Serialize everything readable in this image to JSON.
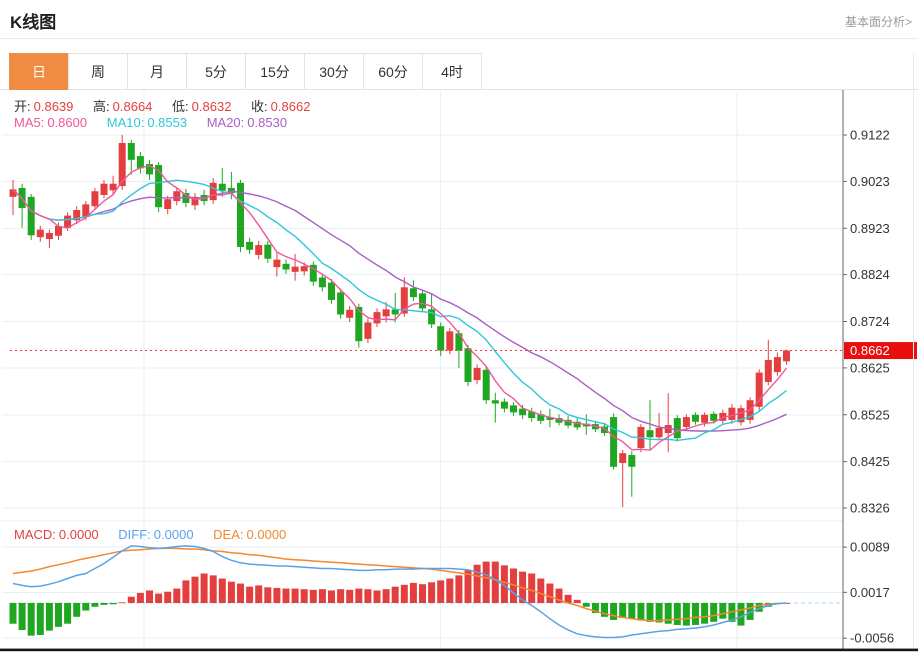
{
  "header": {
    "title": "K线图",
    "link_label": "基本面分析>"
  },
  "tabs": [
    {
      "label": "日",
      "active": true
    },
    {
      "label": "周",
      "active": false
    },
    {
      "label": "月",
      "active": false
    },
    {
      "label": "5分",
      "active": false
    },
    {
      "label": "15分",
      "active": false
    },
    {
      "label": "30分",
      "active": false
    },
    {
      "label": "60分",
      "active": false
    },
    {
      "label": "4时",
      "active": false
    }
  ],
  "ohlc_row": {
    "open_label": "开:",
    "open": "0.8639",
    "high_label": "高:",
    "high": "0.8664",
    "low_label": "低:",
    "low": "0.8632",
    "close_label": "收:",
    "close": "0.8662"
  },
  "ma_row": {
    "ma5_label": "MA5:",
    "ma5": "0.8600",
    "ma10_label": "MA10:",
    "ma10": "0.8553",
    "ma20_label": "MA20:",
    "ma20": "0.8530"
  },
  "macd_row": {
    "macd_label": "MACD:",
    "macd": "0.0000",
    "diff_label": "DIFF:",
    "diff": "0.0000",
    "dea_label": "DEA:",
    "dea": "0.0000"
  },
  "colors": {
    "accent_orange": "#f08c43",
    "candle_up": "#e43f3f",
    "candle_down": "#1fa722",
    "ma5_pink": "#f0579a",
    "ma10_cyan": "#2fc6da",
    "ma20_purple": "#a95fc4",
    "diff_blue": "#58a3e8",
    "dea_orange": "#f2882f",
    "price_tag_bg": "#ea0f0f",
    "price_line_red": "#f03c3c",
    "grid": "#e9eff6",
    "zero_dash": "#a8d8f0",
    "axis": "#666666"
  },
  "chart_data": [
    {
      "type": "candlestick",
      "title": "K线图",
      "legend": [
        "MA5",
        "MA10",
        "MA20"
      ],
      "ma_windows": [
        5,
        10,
        20
      ],
      "y_axis": {
        "ticks": [
          "0.9122",
          "0.9023",
          "0.8923",
          "0.8824",
          "0.8724",
          "0.8625",
          "0.8525",
          "0.8425",
          "0.8326"
        ],
        "range": [
          0.8326,
          0.9122
        ],
        "grid": true
      },
      "current_price": "0.8662",
      "current_price_value": 0.8662,
      "candles": [
        [
          0.899,
          0.9026,
          0.8951,
          0.9006
        ],
        [
          0.9009,
          0.9018,
          0.8924,
          0.8966
        ],
        [
          0.899,
          0.8996,
          0.8898,
          0.8908
        ],
        [
          0.8904,
          0.8928,
          0.8894,
          0.892
        ],
        [
          0.89,
          0.892,
          0.8881,
          0.8913
        ],
        [
          0.8907,
          0.8935,
          0.8898,
          0.8928
        ],
        [
          0.8924,
          0.8957,
          0.8917,
          0.895
        ],
        [
          0.894,
          0.897,
          0.8932,
          0.8962
        ],
        [
          0.8947,
          0.8981,
          0.894,
          0.8974
        ],
        [
          0.897,
          0.9009,
          0.8962,
          0.9002
        ],
        [
          0.8994,
          0.9026,
          0.8987,
          0.9018
        ],
        [
          0.9004,
          0.9035,
          0.8996,
          0.9018
        ],
        [
          0.9013,
          0.9122,
          0.9005,
          0.9105
        ],
        [
          0.9105,
          0.9112,
          0.9037,
          0.9069
        ],
        [
          0.9077,
          0.9086,
          0.904,
          0.9051
        ],
        [
          0.906,
          0.9068,
          0.9026,
          0.9038
        ],
        [
          0.9058,
          0.9064,
          0.8958,
          0.8968
        ],
        [
          0.8964,
          0.8992,
          0.8953,
          0.8985
        ],
        [
          0.8981,
          0.9011,
          0.8972,
          0.9002
        ],
        [
          0.8998,
          0.9007,
          0.8968,
          0.8977
        ],
        [
          0.8972,
          0.8998,
          0.8962,
          0.899
        ],
        [
          0.8994,
          0.9005,
          0.8972,
          0.8981
        ],
        [
          0.8983,
          0.903,
          0.8975,
          0.902
        ],
        [
          0.9018,
          0.9052,
          0.899,
          0.9003
        ],
        [
          0.9009,
          0.9043,
          0.8985,
          0.8998
        ],
        [
          0.902,
          0.9026,
          0.8872,
          0.8883
        ],
        [
          0.8894,
          0.8903,
          0.8868,
          0.8877
        ],
        [
          0.8866,
          0.8896,
          0.8857,
          0.8887
        ],
        [
          0.8888,
          0.8896,
          0.8849,
          0.8858
        ],
        [
          0.884,
          0.8872,
          0.882,
          0.8856
        ],
        [
          0.8847,
          0.8856,
          0.8826,
          0.8835
        ],
        [
          0.883,
          0.8868,
          0.8811,
          0.8841
        ],
        [
          0.8831,
          0.885,
          0.8822,
          0.8842
        ],
        [
          0.8845,
          0.8852,
          0.88,
          0.8809
        ],
        [
          0.8818,
          0.8826,
          0.8788,
          0.8797
        ],
        [
          0.8807,
          0.8815,
          0.8762,
          0.877
        ],
        [
          0.8786,
          0.8794,
          0.873,
          0.8739
        ],
        [
          0.8732,
          0.8757,
          0.8723,
          0.8749
        ],
        [
          0.8755,
          0.8762,
          0.8668,
          0.8682
        ],
        [
          0.8687,
          0.873,
          0.8678,
          0.8722
        ],
        [
          0.872,
          0.8752,
          0.8712,
          0.8744
        ],
        [
          0.8735,
          0.8766,
          0.8722,
          0.875
        ],
        [
          0.875,
          0.8785,
          0.8722,
          0.8739
        ],
        [
          0.8741,
          0.8818,
          0.8734,
          0.8797
        ],
        [
          0.8795,
          0.8812,
          0.8768,
          0.8776
        ],
        [
          0.8784,
          0.8792,
          0.8744,
          0.8752
        ],
        [
          0.875,
          0.8784,
          0.871,
          0.8718
        ],
        [
          0.8714,
          0.8722,
          0.865,
          0.8662
        ],
        [
          0.8662,
          0.871,
          0.8654,
          0.8703
        ],
        [
          0.8699,
          0.8706,
          0.8625,
          0.8662
        ],
        [
          0.8667,
          0.8674,
          0.8586,
          0.8595
        ],
        [
          0.8599,
          0.8632,
          0.859,
          0.8625
        ],
        [
          0.8621,
          0.8628,
          0.8548,
          0.8556
        ],
        [
          0.8556,
          0.8572,
          0.8508,
          0.8549
        ],
        [
          0.8553,
          0.856,
          0.853,
          0.8538
        ],
        [
          0.8545,
          0.8552,
          0.8522,
          0.853
        ],
        [
          0.8538,
          0.8546,
          0.8516,
          0.8524
        ],
        [
          0.8532,
          0.854,
          0.851,
          0.8518
        ],
        [
          0.8526,
          0.8534,
          0.8505,
          0.8512
        ],
        [
          0.852,
          0.8538,
          0.8498,
          0.8514
        ],
        [
          0.8518,
          0.8526,
          0.8502,
          0.8508
        ],
        [
          0.8514,
          0.8522,
          0.8496,
          0.8502
        ],
        [
          0.851,
          0.8518,
          0.8492,
          0.8498
        ],
        [
          0.8506,
          0.8526,
          0.8482,
          0.85
        ],
        [
          0.8505,
          0.8512,
          0.8488,
          0.8494
        ],
        [
          0.85,
          0.8508,
          0.848,
          0.8486
        ],
        [
          0.852,
          0.8528,
          0.8408,
          0.8414
        ],
        [
          0.8422,
          0.845,
          0.8328,
          0.8443
        ],
        [
          0.8439,
          0.8447,
          0.835,
          0.8414
        ],
        [
          0.8454,
          0.8505,
          0.8445,
          0.8499
        ],
        [
          0.8492,
          0.8556,
          0.8449,
          0.8477
        ],
        [
          0.8477,
          0.8529,
          0.847,
          0.8497
        ],
        [
          0.8486,
          0.8571,
          0.8445,
          0.8503
        ],
        [
          0.8518,
          0.8524,
          0.8468,
          0.8475
        ],
        [
          0.8499,
          0.8526,
          0.8492,
          0.852
        ],
        [
          0.8525,
          0.853,
          0.8504,
          0.851
        ],
        [
          0.8508,
          0.853,
          0.85,
          0.8525
        ],
        [
          0.8527,
          0.8532,
          0.8506,
          0.8512
        ],
        [
          0.8512,
          0.8536,
          0.8504,
          0.8529
        ],
        [
          0.8514,
          0.8548,
          0.8506,
          0.854
        ],
        [
          0.8509,
          0.8546,
          0.8502,
          0.8539
        ],
        [
          0.8514,
          0.8562,
          0.8506,
          0.8556
        ],
        [
          0.8542,
          0.8622,
          0.8534,
          0.8615
        ],
        [
          0.8595,
          0.8685,
          0.8588,
          0.8642
        ],
        [
          0.8616,
          0.8658,
          0.8608,
          0.8648
        ],
        [
          0.8639,
          0.8664,
          0.8632,
          0.8662
        ]
      ]
    },
    {
      "type": "bar",
      "title": "MACD",
      "legend": [
        "MACD",
        "DIFF",
        "DEA"
      ],
      "y_axis": {
        "ticks": [
          "0.0089",
          "0.0017",
          "-0.0056"
        ],
        "range": [
          -0.0056,
          0.0089
        ],
        "grid": true,
        "zero_line": true
      },
      "series": [
        {
          "name": "MACD",
          "values": [
            -0.0033,
            -0.0043,
            -0.0052,
            -0.0051,
            -0.0044,
            -0.0038,
            -0.0033,
            -0.0022,
            -0.0012,
            -0.0006,
            -0.0003,
            -0.0002,
            0.0001,
            0.001,
            0.0016,
            0.002,
            0.0015,
            0.0018,
            0.0023,
            0.0036,
            0.0042,
            0.0047,
            0.0044,
            0.0039,
            0.0034,
            0.0031,
            0.0026,
            0.0028,
            0.0025,
            0.0024,
            0.0023,
            0.0023,
            0.0022,
            0.0021,
            0.0022,
            0.002,
            0.0022,
            0.0021,
            0.0023,
            0.0022,
            0.002,
            0.0022,
            0.0026,
            0.0029,
            0.0032,
            0.003,
            0.0033,
            0.0036,
            0.0039,
            0.0044,
            0.0052,
            0.0061,
            0.0066,
            0.0066,
            0.006,
            0.0055,
            0.005,
            0.0047,
            0.0039,
            0.0031,
            0.0023,
            0.0013,
            0.0005,
            -0.0006,
            -0.0016,
            -0.0022,
            -0.0027,
            -0.0024,
            -0.0025,
            -0.0028,
            -0.003,
            -0.0031,
            -0.0033,
            -0.0035,
            -0.0036,
            -0.0035,
            -0.0033,
            -0.003,
            -0.0025,
            -0.003,
            -0.0036,
            -0.0027,
            -0.0014,
            -0.0006,
            0.0,
            0.0
          ]
        },
        {
          "name": "DIFF",
          "values": [
            0.0031,
            0.0028,
            0.0026,
            0.0027,
            0.003,
            0.0034,
            0.0039,
            0.0044,
            0.0047,
            0.0055,
            0.0063,
            0.0073,
            0.0083,
            0.0091,
            0.009,
            0.0088,
            0.0087,
            0.0088,
            0.009,
            0.0091,
            0.009,
            0.0087,
            0.0082,
            0.0074,
            0.0068,
            0.0064,
            0.0062,
            0.0061,
            0.006,
            0.0059,
            0.0059,
            0.0058,
            0.0057,
            0.0056,
            0.0055,
            0.0055,
            0.0054,
            0.0053,
            0.0052,
            0.0052,
            0.0053,
            0.0053,
            0.0054,
            0.0054,
            0.0054,
            0.0055,
            0.0055,
            0.0055,
            0.0055,
            0.0054,
            0.0053,
            0.0049,
            0.0045,
            0.0037,
            0.0028,
            0.0016,
            0.0005,
            -0.0004,
            -0.0014,
            -0.0025,
            -0.0035,
            -0.0043,
            -0.0049,
            -0.0052,
            -0.0054,
            -0.0055,
            -0.0055,
            -0.0054,
            -0.0051,
            -0.0049,
            -0.0047,
            -0.0045,
            -0.0044,
            -0.0042,
            -0.0041,
            -0.004,
            -0.0038,
            -0.0035,
            -0.0031,
            -0.0027,
            -0.0022,
            -0.0015,
            -0.0009,
            -0.0004,
            -0.0001,
            0.0
          ]
        },
        {
          "name": "DEA",
          "values": [
            0.0047,
            0.0049,
            0.0051,
            0.0054,
            0.0058,
            0.0061,
            0.0064,
            0.0068,
            0.0071,
            0.0074,
            0.0077,
            0.008,
            0.0083,
            0.0084,
            0.0085,
            0.0086,
            0.0087,
            0.0087,
            0.0087,
            0.0086,
            0.0086,
            0.0085,
            0.0083,
            0.0082,
            0.008,
            0.0079,
            0.0077,
            0.0076,
            0.0074,
            0.0072,
            0.007,
            0.0069,
            0.0068,
            0.0067,
            0.0066,
            0.0065,
            0.0064,
            0.0063,
            0.0062,
            0.0061,
            0.006,
            0.0059,
            0.0058,
            0.0057,
            0.0056,
            0.0055,
            0.0054,
            0.0052,
            0.005,
            0.0048,
            0.0046,
            0.0043,
            0.004,
            0.0037,
            0.0033,
            0.0029,
            0.0024,
            0.002,
            0.0015,
            0.001,
            0.0005,
            0.0,
            -0.0004,
            -0.0009,
            -0.0013,
            -0.0017,
            -0.002,
            -0.0023,
            -0.0025,
            -0.0027,
            -0.0028,
            -0.0028,
            -0.0027,
            -0.0026,
            -0.0025,
            -0.0023,
            -0.0022,
            -0.002,
            -0.0017,
            -0.0014,
            -0.0011,
            -0.0008,
            -0.0004,
            -0.0002,
            -0.0001,
            0.0
          ]
        }
      ]
    }
  ]
}
